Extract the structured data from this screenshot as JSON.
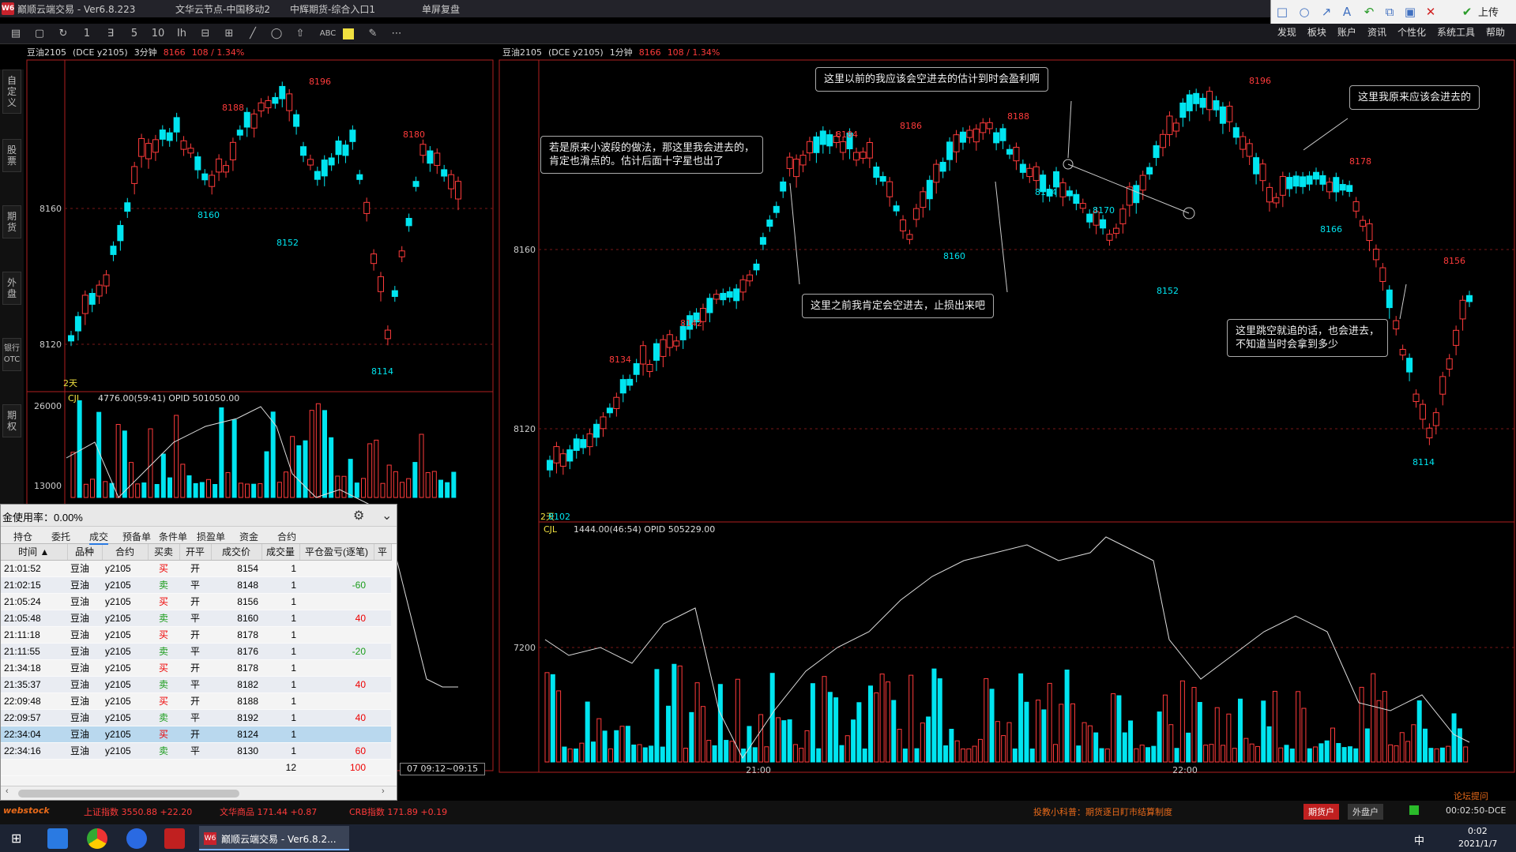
{
  "window": {
    "title": "巅顺云端交易 - Ver6.8.223",
    "node": "文华云节点-中国移动2",
    "channel": "中辉期货-综合入口1",
    "mode": "单屏复盘"
  },
  "menu": [
    "发现",
    "板块",
    "账户",
    "资讯",
    "个性化",
    "系统工具",
    "帮助"
  ],
  "upload_label": "上传",
  "toolbar": [
    "1",
    "∃",
    "5",
    "10",
    "Ih",
    "⊟",
    "⊞",
    "╱",
    "◯",
    "⇧",
    "ABC"
  ],
  "side_tabs": [
    "自定义",
    "股票",
    "期货",
    "外盘",
    "银行OTC",
    "期权"
  ],
  "left_chart": {
    "name": "豆油2105",
    "exch": "(DCE y2105)",
    "period": "3分钟",
    "price": "8166",
    "change": "108 / 1.34%",
    "yticks": [
      "8160",
      "8120"
    ],
    "days_label": "2天",
    "highs": [
      {
        "v": "8188"
      },
      {
        "v": "8196"
      },
      {
        "v": "8180"
      }
    ],
    "lows": [
      {
        "v": "8160"
      },
      {
        "v": "8152"
      },
      {
        "v": "8114"
      }
    ],
    "vol": {
      "label": "CJL",
      "info": "4776.00(59:41)  OPID 501050.00",
      "yticks": [
        "26000",
        "13000"
      ]
    }
  },
  "right_chart": {
    "name": "豆油2105",
    "exch": "(DCE y2105)",
    "period": "1分钟",
    "price": "8166",
    "change": "108 / 1.34%",
    "yticks": [
      "8160",
      "8120"
    ],
    "days_label": "2天",
    "labels": [
      {
        "v": "8196",
        "c": "r"
      },
      {
        "v": "8184",
        "c": "r"
      },
      {
        "v": "8186",
        "c": "r"
      },
      {
        "v": "8188",
        "c": "r"
      },
      {
        "v": "8178",
        "c": "r"
      },
      {
        "v": "8142",
        "c": "r"
      },
      {
        "v": "8134",
        "c": "r"
      },
      {
        "v": "8156",
        "c": "r"
      },
      {
        "v": "8174",
        "c": "c"
      },
      {
        "v": "8170",
        "c": "c"
      },
      {
        "v": "8160",
        "c": "c"
      },
      {
        "v": "8166",
        "c": "c"
      },
      {
        "v": "8152",
        "c": "c"
      },
      {
        "v": "8114",
        "c": "c"
      },
      {
        "v": "8102",
        "c": "c"
      }
    ],
    "vol": {
      "label": "CJL",
      "info": "1444.00(46:54)  OPID 505229.00",
      "ytick": "7200"
    },
    "xticks": [
      "21:00",
      "22:00"
    ],
    "notes": [
      "这里以前的我应该会空进去的估计到时会盈利啊",
      "这里我原来应该会进去的",
      "若是原来小波段的做法，那这里我会进去的，\n肯定也滑点的。估计后面十字星也出了",
      "这里之前我肯定会空进去，止损出来吧",
      "这里跳空就追的话，也会进去，\n不知道当时会拿到多少"
    ]
  },
  "trade_panel": {
    "usage": "金使用率：0.00%",
    "tabs": [
      "持仓",
      "委托",
      "成交",
      "预备单",
      "条件单",
      "损盈单",
      "资金",
      "合约"
    ],
    "columns": [
      "时间 ▲",
      "品种",
      "合约",
      "买卖",
      "开平",
      "成交价",
      "成交量",
      "平仓盈亏(逐笔)",
      "平"
    ],
    "rows": [
      [
        "21:01:52",
        "豆油",
        "y2105",
        "买",
        "开",
        "8154",
        "1",
        ""
      ],
      [
        "21:02:15",
        "豆油",
        "y2105",
        "卖",
        "平",
        "8148",
        "1",
        "-60"
      ],
      [
        "21:05:24",
        "豆油",
        "y2105",
        "买",
        "开",
        "8156",
        "1",
        ""
      ],
      [
        "21:05:48",
        "豆油",
        "y2105",
        "卖",
        "平",
        "8160",
        "1",
        "40"
      ],
      [
        "21:11:18",
        "豆油",
        "y2105",
        "买",
        "开",
        "8178",
        "1",
        ""
      ],
      [
        "21:11:55",
        "豆油",
        "y2105",
        "卖",
        "平",
        "8176",
        "1",
        "-20"
      ],
      [
        "21:34:18",
        "豆油",
        "y2105",
        "买",
        "开",
        "8178",
        "1",
        ""
      ],
      [
        "21:35:37",
        "豆油",
        "y2105",
        "卖",
        "平",
        "8182",
        "1",
        "40"
      ],
      [
        "22:09:48",
        "豆油",
        "y2105",
        "买",
        "开",
        "8188",
        "1",
        ""
      ],
      [
        "22:09:57",
        "豆油",
        "y2105",
        "卖",
        "平",
        "8192",
        "1",
        "40"
      ],
      [
        "22:34:04",
        "豆油",
        "y2105",
        "买",
        "开",
        "8124",
        "1",
        ""
      ],
      [
        "22:34:16",
        "豆油",
        "y2105",
        "卖",
        "平",
        "8130",
        "1",
        "60"
      ]
    ],
    "totals": {
      "qty": "12",
      "pnl": "100"
    },
    "time_range": "07 09:12~09:15"
  },
  "status": {
    "brand": "webstock",
    "idx1": "上证指数  3550.88  +22.20",
    "idx2": "文华商品  171.44  +0.87",
    "idx3": "CRB指数  171.89  +0.19",
    "notice": "投教小科普：期货逐日盯市结算制度",
    "btn1": "期货户",
    "btn2": "外盘户",
    "clock": "00:02:50-DCE",
    "forum": "论坛提问"
  },
  "taskbar": {
    "app": "巅顺云端交易 - Ver6.8.2...",
    "ime": "中",
    "time": "0:02",
    "date": "2021/1/7"
  }
}
